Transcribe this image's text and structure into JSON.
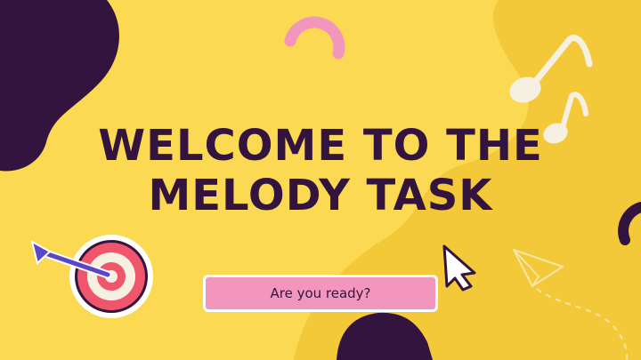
{
  "slide": {
    "title_line1": "WELCOME TO THE",
    "title_line2": "MELODY TASK",
    "cta_label": "Are you ready?"
  },
  "colors": {
    "background": "#fbd953",
    "accent_blob": "#f3c93a",
    "dark": "#33143f",
    "pink": "#f296bd",
    "cream": "#f6f0e2",
    "target_red": "#f0566b",
    "dart_purple": "#5a47c7"
  },
  "icons": [
    "music-notes-icon",
    "dart-target-icon",
    "cursor-arrow-icon",
    "paper-plane-icon"
  ]
}
